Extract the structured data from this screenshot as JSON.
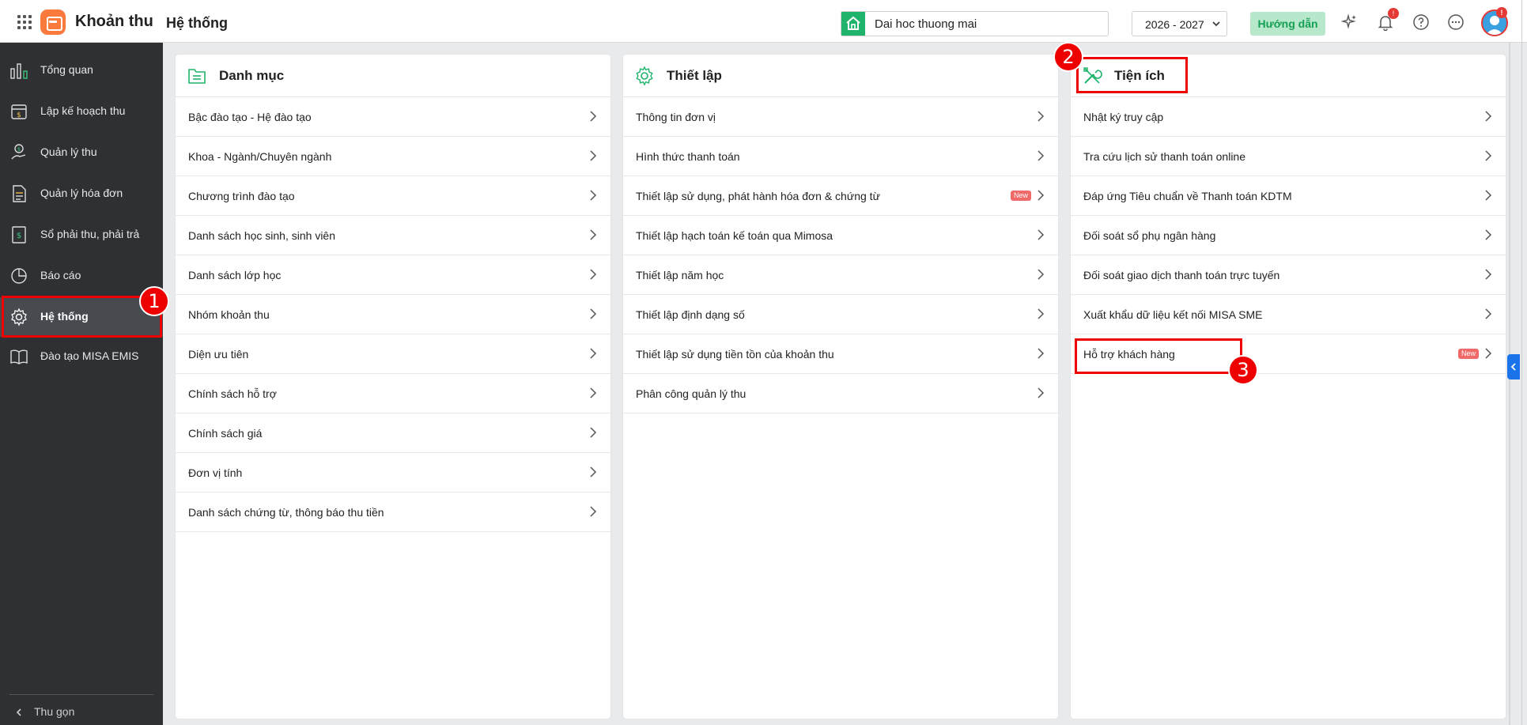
{
  "header": {
    "app_name": "Khoản thu",
    "page_title": "Hệ thống",
    "unit_name": "Dai hoc thuong mai",
    "school_year": "2026 - 2027",
    "guide_label": "Hướng dẫn",
    "notification_badge": "!",
    "avatar_badge": "!"
  },
  "sidebar": {
    "items": [
      {
        "label": "Tổng quan",
        "icon": "bar-chart-icon"
      },
      {
        "label": "Lập kế hoạch thu",
        "icon": "calendar-money-icon"
      },
      {
        "label": "Quản lý thu",
        "icon": "hand-coin-icon"
      },
      {
        "label": "Quản lý hóa đơn",
        "icon": "invoice-icon"
      },
      {
        "label": "Sổ phải thu, phải trả",
        "icon": "ledger-icon"
      },
      {
        "label": "Báo cáo",
        "icon": "pie-chart-icon"
      },
      {
        "label": "Hệ thống",
        "icon": "gear-icon",
        "active": true
      },
      {
        "label": "Đào tạo MISA EMIS",
        "icon": "book-icon"
      }
    ],
    "collapse_label": "Thu gọn"
  },
  "panels": {
    "danh_muc": {
      "title": "Danh mục",
      "rows": [
        "Bậc đào tạo - Hệ đào tạo",
        "Khoa - Ngành/Chuyên ngành",
        "Chương trình đào tạo",
        "Danh sách học sinh, sinh viên",
        "Danh sách lớp học",
        "Nhóm khoản thu",
        "Diện ưu tiên",
        "Chính sách hỗ trợ",
        "Chính sách giá",
        "Đơn vị tính",
        "Danh sách chứng từ, thông báo thu tiền"
      ]
    },
    "thiet_lap": {
      "title": "Thiết lập",
      "rows": [
        "Thông tin đơn vị",
        "Hình thức thanh toán",
        "Thiết lập sử dụng, phát hành hóa đơn & chứng từ",
        "Thiết lập hạch toán kế toán qua Mimosa",
        "Thiết lập năm học",
        "Thiết lập định dạng số",
        "Thiết lập sử dụng tiền tồn của khoản thu",
        "Phân công quản lý thu"
      ],
      "new_badge": "New"
    },
    "tien_ich": {
      "title": "Tiện ích",
      "rows": [
        "Nhật ký truy cập",
        "Tra cứu lịch sử thanh toán online",
        "Đáp ứng Tiêu chuẩn về Thanh toán KDTM",
        "Đối soát sổ phụ ngân hàng",
        "Đối soát giao dịch thanh toán trực tuyến",
        "Xuất khẩu dữ liệu kết nối MISA SME",
        "Hỗ trợ khách hàng"
      ],
      "new_badge": "New"
    }
  },
  "annotations": {
    "step1": "1",
    "step2": "2",
    "step3": "3",
    "color": "#e00000"
  },
  "colors": {
    "sidebar_bg": "#2e3033",
    "accent_green": "#20b36b",
    "guide_bg": "#b8e8cc",
    "logo_orange": "#f97a3c",
    "new_badge": "#f06a6a"
  }
}
